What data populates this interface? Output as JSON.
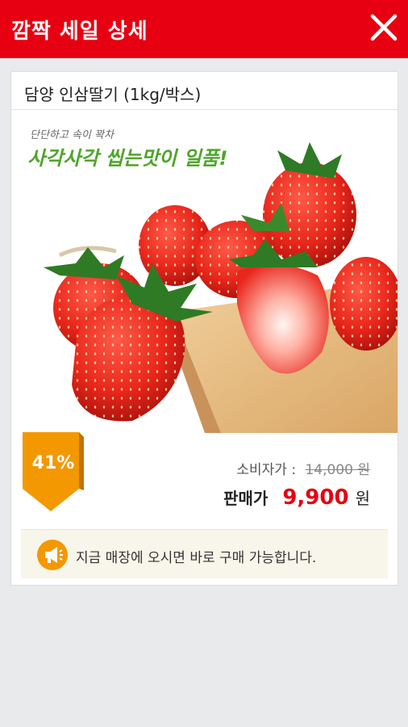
{
  "header": {
    "title": "깜짝 세일 상세",
    "close_icon": "close-icon",
    "background_color": "#e60012"
  },
  "product": {
    "title": "담양 인삼딸기 (1kg/박스)",
    "image": {
      "tagline": "단단하고 속이 꽉차",
      "slogan": "사각사각 씹는맛이 일품!"
    },
    "discount": "41%",
    "consumer_price_label": "소비자가 :",
    "consumer_price": "14,000 원",
    "sale_price_label": "판매가",
    "sale_price": "9,900",
    "sale_price_unit": "원"
  },
  "notice": {
    "icon": "megaphone-icon",
    "text": "지금 매장에 오시면 바로 구매 가능합니다."
  },
  "colors": {
    "accent": "#e60012",
    "slogan_green": "#4fa52b",
    "badge_orange": "#f39800"
  }
}
